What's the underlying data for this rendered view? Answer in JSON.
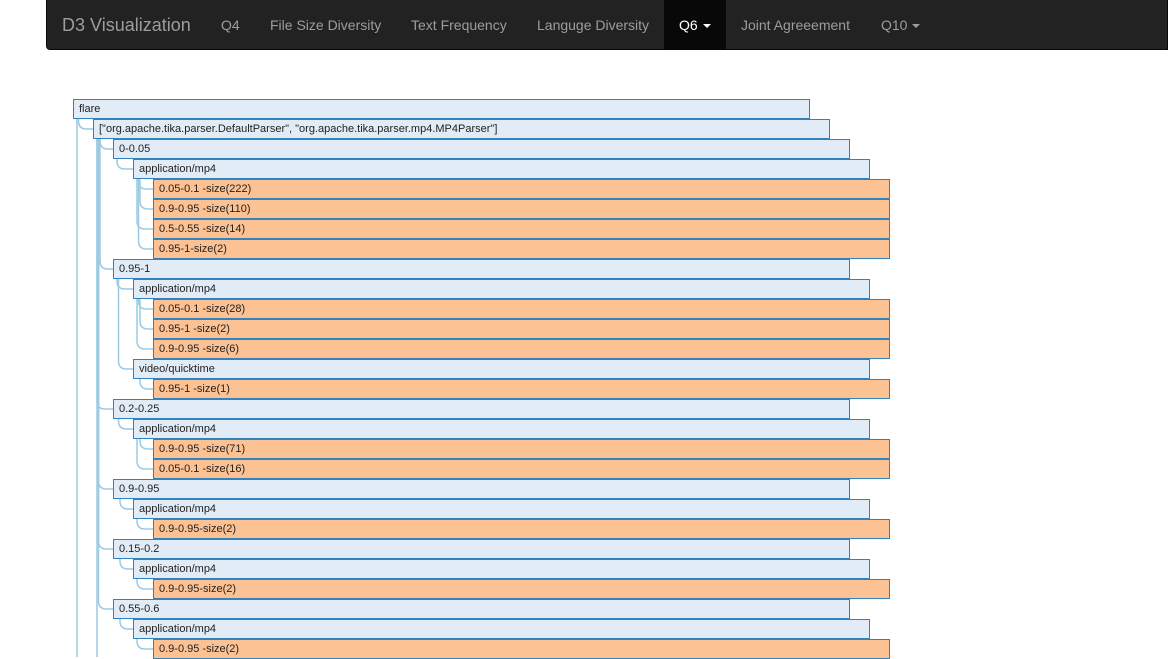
{
  "navbar": {
    "brand": "D3 Visualization",
    "items": [
      {
        "label": "Q4",
        "active": false,
        "dropdown": false
      },
      {
        "label": "File Size Diversity",
        "active": false,
        "dropdown": false
      },
      {
        "label": "Text Frequency",
        "active": false,
        "dropdown": false
      },
      {
        "label": "Languge Diversity",
        "active": false,
        "dropdown": false
      },
      {
        "label": "Q6",
        "active": true,
        "dropdown": true
      },
      {
        "label": "Joint Agreeement",
        "active": false,
        "dropdown": false
      },
      {
        "label": "Q10",
        "active": false,
        "dropdown": true
      }
    ]
  },
  "colors": {
    "navbar_bg": "#222222",
    "active_bg": "#080808",
    "node_border": "#3182bd",
    "collapsed_node_fill": "#e2ecf7",
    "leaf_node_fill": "#fdc293",
    "link_stroke": "#9ecae1"
  },
  "tree": {
    "nodes": [
      {
        "label": "flare",
        "depth": 0,
        "leaf": false
      },
      {
        "label": "[\"org.apache.tika.parser.DefaultParser\", \"org.apache.tika.parser.mp4.MP4Parser\"]",
        "depth": 1,
        "leaf": false
      },
      {
        "label": "0-0.05",
        "depth": 2,
        "leaf": false
      },
      {
        "label": "application/mp4",
        "depth": 3,
        "leaf": false
      },
      {
        "label": "0.05-0.1 -size(222)",
        "depth": 4,
        "leaf": true
      },
      {
        "label": "0.9-0.95 -size(110)",
        "depth": 4,
        "leaf": true
      },
      {
        "label": "0.5-0.55 -size(14)",
        "depth": 4,
        "leaf": true
      },
      {
        "label": "0.95-1-size(2)",
        "depth": 4,
        "leaf": true
      },
      {
        "label": "0.95-1",
        "depth": 2,
        "leaf": false
      },
      {
        "label": "application/mp4",
        "depth": 3,
        "leaf": false
      },
      {
        "label": "0.05-0.1 -size(28)",
        "depth": 4,
        "leaf": true
      },
      {
        "label": "0.95-1 -size(2)",
        "depth": 4,
        "leaf": true
      },
      {
        "label": "0.9-0.95 -size(6)",
        "depth": 4,
        "leaf": true
      },
      {
        "label": "video/quicktime",
        "depth": 3,
        "leaf": false
      },
      {
        "label": "0.95-1 -size(1)",
        "depth": 4,
        "leaf": true
      },
      {
        "label": "0.2-0.25",
        "depth": 2,
        "leaf": false
      },
      {
        "label": "application/mp4",
        "depth": 3,
        "leaf": false
      },
      {
        "label": "0.9-0.95 -size(71)",
        "depth": 4,
        "leaf": true
      },
      {
        "label": "0.05-0.1 -size(16)",
        "depth": 4,
        "leaf": true
      },
      {
        "label": "0.9-0.95",
        "depth": 2,
        "leaf": false
      },
      {
        "label": "application/mp4",
        "depth": 3,
        "leaf": false
      },
      {
        "label": "0.9-0.95-size(2)",
        "depth": 4,
        "leaf": true
      },
      {
        "label": "0.15-0.2",
        "depth": 2,
        "leaf": false
      },
      {
        "label": "application/mp4",
        "depth": 3,
        "leaf": false
      },
      {
        "label": "0.9-0.95-size(2)",
        "depth": 4,
        "leaf": true
      },
      {
        "label": "0.55-0.6",
        "depth": 2,
        "leaf": false
      },
      {
        "label": "application/mp4",
        "depth": 3,
        "leaf": false
      },
      {
        "label": "0.9-0.95 -size(2)",
        "depth": 4,
        "leaf": true
      }
    ]
  }
}
